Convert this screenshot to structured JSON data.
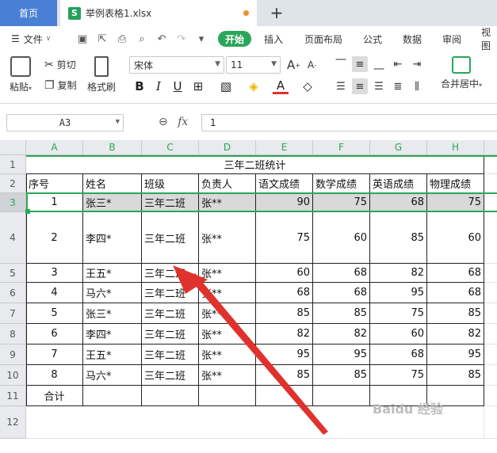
{
  "tabs": {
    "home": "首页",
    "file": "举例表格1.xlsx",
    "file_icon": "S",
    "add": "+"
  },
  "menu": {
    "file": "文件",
    "items": [
      "开始",
      "插入",
      "页面布局",
      "公式",
      "数据",
      "审阅",
      "视图"
    ]
  },
  "ribbon": {
    "paste": "粘贴",
    "cut": "剪切",
    "copy": "复制",
    "format_painter": "格式刷",
    "font_name": "宋体",
    "font_size": "11",
    "merge_center": "合并居中"
  },
  "formula_bar": {
    "name_box": "A3",
    "fx": "fx",
    "value": "1"
  },
  "columns": [
    "A",
    "B",
    "C",
    "D",
    "E",
    "F",
    "G",
    "H"
  ],
  "rows": [
    "1",
    "2",
    "3",
    "4",
    "5",
    "6",
    "7",
    "8",
    "9",
    "10",
    "11",
    "12"
  ],
  "sheet": {
    "title": "三年二班统计",
    "headers": [
      "序号",
      "姓名",
      "班级",
      "负责人",
      "语文成绩",
      "数学成绩",
      "英语成绩",
      "物理成绩"
    ],
    "data_rows": [
      [
        "1",
        "张三*",
        "三年二班",
        "张**",
        "90",
        "75",
        "68",
        "75"
      ],
      [
        "2",
        "李四*",
        "三年二班",
        "张**",
        "75",
        "60",
        "85",
        "60"
      ],
      [
        "3",
        "王五*",
        "三年二班",
        "张**",
        "60",
        "68",
        "82",
        "68"
      ],
      [
        "4",
        "马六*",
        "三年二班",
        "张**",
        "68",
        "68",
        "95",
        "68"
      ],
      [
        "5",
        "张三*",
        "三年二班",
        "张**",
        "85",
        "85",
        "75",
        "85"
      ],
      [
        "6",
        "李四*",
        "三年二班",
        "张**",
        "82",
        "82",
        "60",
        "82"
      ],
      [
        "7",
        "王五*",
        "三年二班",
        "张**",
        "95",
        "95",
        "68",
        "95"
      ],
      [
        "8",
        "马六*",
        "三年二班",
        "张**",
        "85",
        "85",
        "75",
        "85"
      ]
    ],
    "total_label": "合计"
  },
  "watermark": "Baidu 经验",
  "colors": {
    "accent_green": "#2aa65b",
    "home_tab_blue": "#4a7fd6",
    "arrow_red": "#e0322c"
  }
}
